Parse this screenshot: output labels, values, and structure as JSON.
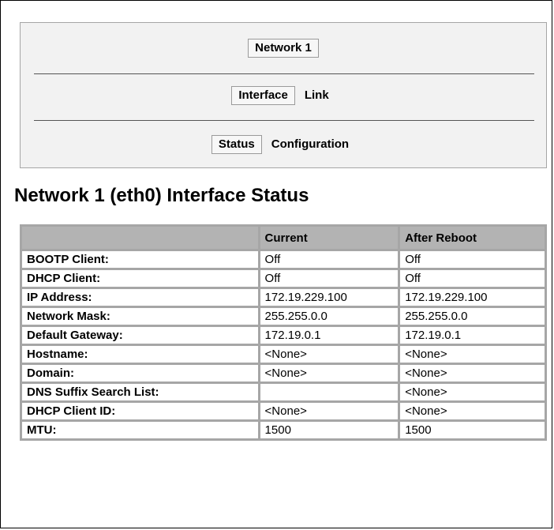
{
  "nav": {
    "row1": {
      "button_label": "Network 1"
    },
    "row2": {
      "button_label": "Interface",
      "link_label": "Link"
    },
    "row3": {
      "button_label": "Status",
      "link_label": "Configuration"
    }
  },
  "page_title": "Network 1 (eth0) Interface Status",
  "table": {
    "headers": [
      "",
      "Current",
      "After Reboot"
    ],
    "rows": [
      {
        "label": "BOOTP Client:",
        "current": "Off",
        "after_reboot": "Off"
      },
      {
        "label": "DHCP Client:",
        "current": "Off",
        "after_reboot": "Off"
      },
      {
        "label": "IP Address:",
        "current": "172.19.229.100",
        "after_reboot": "172.19.229.100"
      },
      {
        "label": "Network Mask:",
        "current": "255.255.0.0",
        "after_reboot": "255.255.0.0"
      },
      {
        "label": "Default Gateway:",
        "current": "172.19.0.1",
        "after_reboot": "172.19.0.1"
      },
      {
        "label": "Hostname:",
        "current": "<None>",
        "after_reboot": "<None>"
      },
      {
        "label": "Domain:",
        "current": "<None>",
        "after_reboot": "<None>"
      },
      {
        "label": "DNS Suffix Search List:",
        "current": "",
        "after_reboot": "<None>"
      },
      {
        "label": "DHCP Client ID:",
        "current": "<None>",
        "after_reboot": "<None>"
      },
      {
        "label": "MTU:",
        "current": "1500",
        "after_reboot": "1500"
      }
    ]
  },
  "colors": {
    "panel_bg": "#f2f2f2",
    "table_header_bg": "#b3b3b3",
    "table_border": "#a6a6a6"
  }
}
